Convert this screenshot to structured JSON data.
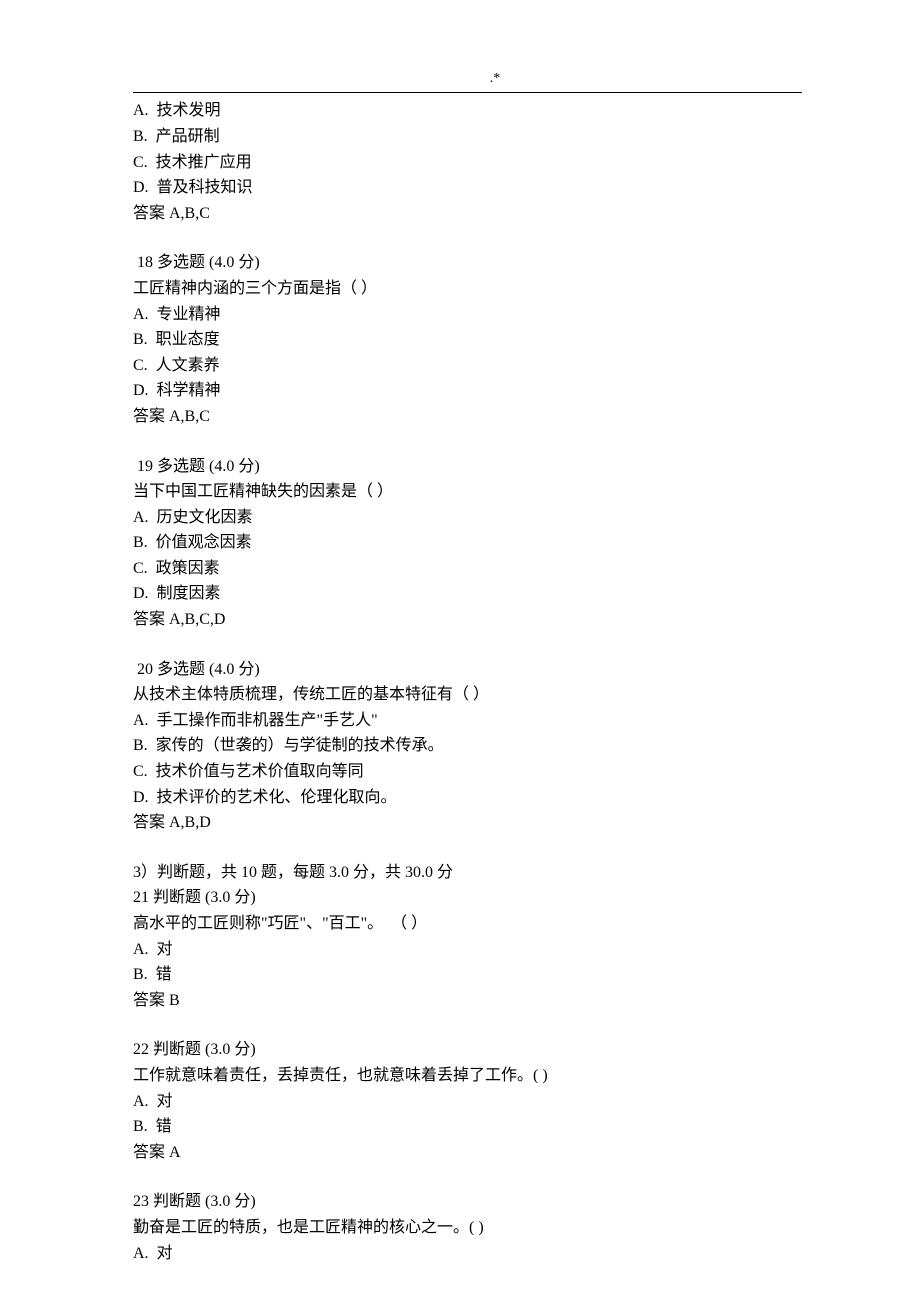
{
  "header": ".*",
  "q17": {
    "options": {
      "A": "A.  技术发明",
      "B": "B.  产品研制",
      "C": "C.  技术推广应用",
      "D": "D.  普及科技知识"
    },
    "answer": "答案 A,B,C"
  },
  "q18": {
    "title": " 18 多选题 (4.0 分)",
    "stem": "工匠精神内涵的三个方面是指（ ）",
    "options": {
      "A": "A.  专业精神",
      "B": "B.  职业态度",
      "C": "C.  人文素养",
      "D": "D.  科学精神"
    },
    "answer": "答案 A,B,C"
  },
  "q19": {
    "title": " 19 多选题 (4.0 分)",
    "stem": "当下中国工匠精神缺失的因素是（ ）",
    "options": {
      "A": "A.  历史文化因素",
      "B": "B.  价值观念因素",
      "C": "C.  政策因素",
      "D": "D.  制度因素"
    },
    "answer": "答案 A,B,C,D"
  },
  "q20": {
    "title": " 20 多选题 (4.0 分)",
    "stem": "从技术主体特质梳理，传统工匠的基本特征有（ ）",
    "options": {
      "A": "A.  手工操作而非机器生产\"手艺人\"",
      "B": "B.  家传的（世袭的）与学徒制的技术传承。",
      "C": "C.  技术价值与艺术价值取向等同",
      "D": "D.  技术评价的艺术化、伦理化取向。"
    },
    "answer": "答案 A,B,D"
  },
  "section3": {
    "title": "3）判断题，共 10 题，每题 3.0 分，共 30.0 分"
  },
  "q21": {
    "title": "21 判断题 (3.0 分)",
    "stem": "高水平的工匠则称\"巧匠\"、\"百工\"。  （ ）",
    "options": {
      "A": "A.  对",
      "B": "B.  错"
    },
    "answer": "答案 B"
  },
  "q22": {
    "title": "22 判断题 (3.0 分)",
    "stem": "工作就意味着责任，丢掉责任，也就意味着丢掉了工作。( )",
    "options": {
      "A": "A.  对",
      "B": "B.  错"
    },
    "answer": "答案 A"
  },
  "q23": {
    "title": "23 判断题 (3.0 分)",
    "stem": "勤奋是工匠的特质，也是工匠精神的核心之一。( )",
    "options": {
      "A": "A.  对"
    }
  }
}
